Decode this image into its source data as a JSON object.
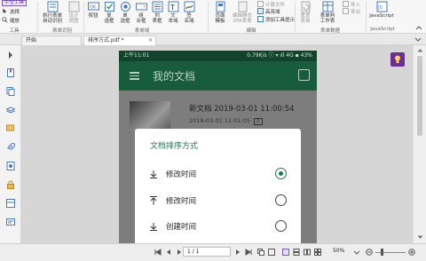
{
  "ribbon": {
    "small_buttons": [
      "手型工具",
      "选择",
      "缩放"
    ],
    "tools_group": "工具",
    "buttons": [
      {
        "label": "执行表单\n自动识别",
        "disabled": false
      },
      {
        "label": "设计\n视图",
        "disabled": true
      },
      {
        "label": "按钮",
        "disabled": false
      },
      {
        "label": "复\n选框",
        "disabled": false
      },
      {
        "label": "单\n选框",
        "disabled": false
      },
      {
        "label": "组\n合框",
        "disabled": false
      },
      {
        "label": "列\n表框",
        "disabled": false
      },
      {
        "label": "文\n本域",
        "disabled": false
      },
      {
        "label": "签\n名域",
        "disabled": false
      },
      {
        "label": "页面\n模板",
        "disabled": false
      },
      {
        "label": "编辑静态\nXFA表单",
        "disabled": true
      },
      {
        "label": "重置\n表单",
        "disabled": true
      },
      {
        "label": "表单判\n工作表",
        "disabled": false
      },
      {
        "label": "JavaScript",
        "disabled": false
      }
    ],
    "edit_small": [
      "计算文件",
      "高亮域",
      "添加工具提示"
    ],
    "form_data_small": [
      "导入",
      "导出"
    ],
    "groups": [
      "表单识别",
      "表单域",
      "编辑",
      "表单数据",
      "JavaScript"
    ]
  },
  "tabs": [
    {
      "label": "开始"
    },
    {
      "label": "排序方式.pdf *"
    }
  ],
  "phone": {
    "status_left": "上午11:01",
    "status_right": "0.79K/s ⓘ ▾ ıll 4G ▪ 43%",
    "app_title": "我的文档",
    "doc_title": "新文档 2019-03-01 11:00:54",
    "doc_meta": "2019-03-01 11:01:05",
    "doc_badge": "2",
    "dialog_title": "文档排序方式",
    "options": [
      {
        "label": "修改时间",
        "icon": "arrow-down-icon",
        "selected": true
      },
      {
        "label": "修改时间",
        "icon": "arrow-up-icon",
        "selected": false
      },
      {
        "label": "创建时间",
        "icon": "arrow-down-icon",
        "selected": false
      }
    ]
  },
  "bottom": {
    "page": "1 / 1",
    "zoom": "50%"
  },
  "colors": {
    "appbar": "#185d3b",
    "status": "#12442d",
    "accent": "#1b7a4c",
    "bulb": "#6a2e97"
  }
}
